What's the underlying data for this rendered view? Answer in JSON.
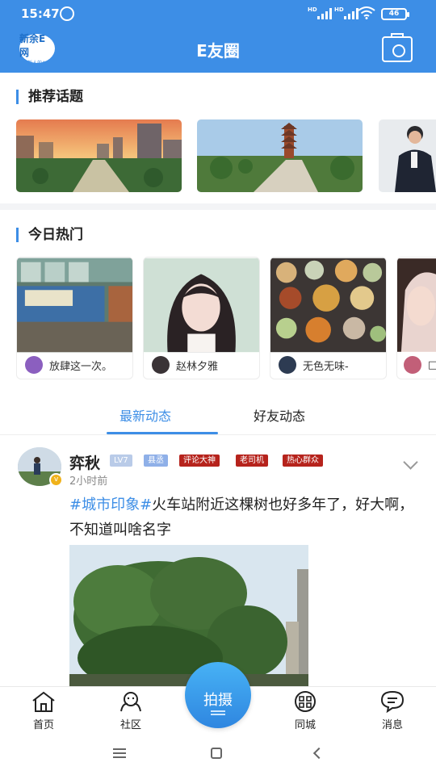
{
  "status_bar": {
    "time": "15:47",
    "network1": "HD",
    "network2": "HD",
    "battery": "46"
  },
  "header": {
    "logo_text": "新余E网",
    "logo_sub": "新人的AI",
    "title": "E友圈"
  },
  "recommended": {
    "title": "推荐话题",
    "topics": [
      {
        "image": "city-sunset"
      },
      {
        "image": "pagoda-park"
      },
      {
        "image": "businessman"
      }
    ]
  },
  "hot_today": {
    "title": "今日热门",
    "items": [
      {
        "image": "shop-counter",
        "name": "放肆这一次。"
      },
      {
        "image": "girl-portrait",
        "name": "赵林夕雅"
      },
      {
        "image": "food-table",
        "name": "无色无味-"
      },
      {
        "image": "girl-partial",
        "name": "□"
      }
    ]
  },
  "tabs": [
    {
      "label": "最新动态",
      "active": true
    },
    {
      "label": "好友动态",
      "active": false
    }
  ],
  "post": {
    "username": "弈秋",
    "badges": [
      {
        "text": "LV7",
        "color": "#b9cbe8"
      },
      {
        "text": "县丞",
        "color": "#8fb0e8"
      },
      {
        "text": "评论大神",
        "color": "#b6231c"
      },
      {
        "text": "老司机",
        "color": "#b6231c"
      },
      {
        "text": "热心群众",
        "color": "#b6231c"
      }
    ],
    "time": "2小时前",
    "hashtag": "#城市印象#",
    "text": "火车站附近这棵树也好多年了，好大啊，不知道叫啥名字"
  },
  "bottom_nav": [
    {
      "label": "首页",
      "icon": "home-icon"
    },
    {
      "label": "社区",
      "icon": "community-icon"
    },
    {
      "label": "拍摄",
      "icon": "shoot-icon"
    },
    {
      "label": "同城",
      "icon": "city-icon"
    },
    {
      "label": "消息",
      "icon": "message-icon"
    }
  ],
  "colors": {
    "primary": "#3d8ee6",
    "badge_red": "#b6231c"
  }
}
